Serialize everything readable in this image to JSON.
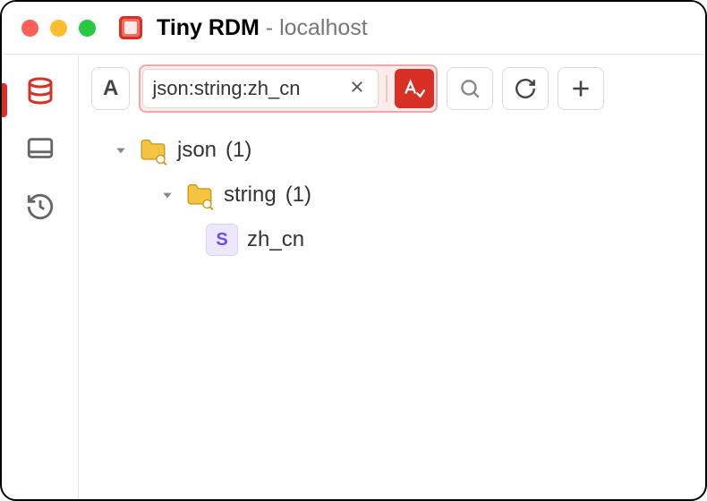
{
  "window": {
    "app_name": "Tiny RDM",
    "connection": "localhost"
  },
  "toolbar": {
    "filter_mode_label": "A",
    "filter_value": "json:string:zh_cn",
    "match_icon": "match-case-icon",
    "search_icon": "search-icon",
    "refresh_icon": "refresh-icon",
    "add_icon": "plus-icon"
  },
  "tree": {
    "nodes": [
      {
        "label": "json",
        "count": "(1)"
      },
      {
        "label": "string",
        "count": "(1)"
      },
      {
        "label": "zh_cn",
        "type_badge": "S"
      }
    ]
  }
}
